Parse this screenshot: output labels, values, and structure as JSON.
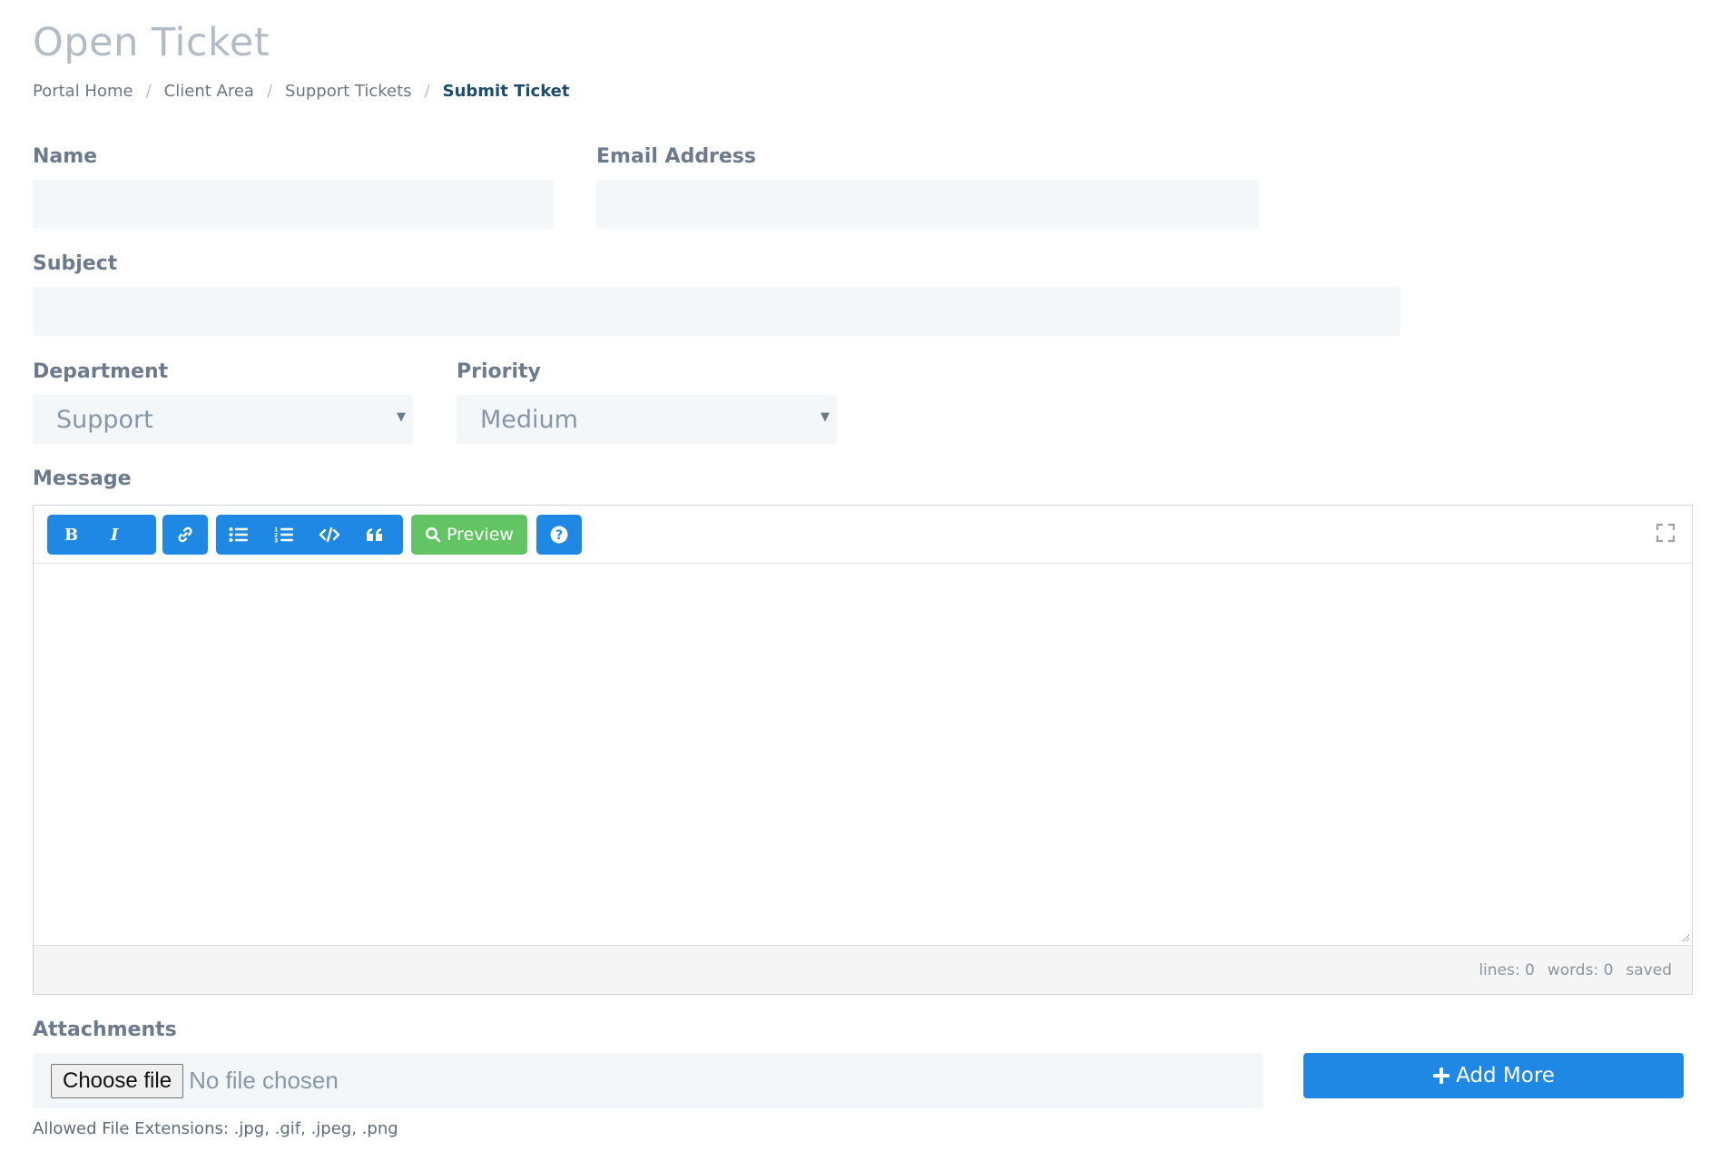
{
  "page": {
    "title": "Open Ticket"
  },
  "breadcrumb": [
    "Portal Home",
    "Client Area",
    "Support Tickets",
    "Submit Ticket"
  ],
  "form": {
    "name_label": "Name",
    "name_value": "",
    "email_label": "Email Address",
    "email_value": "",
    "subject_label": "Subject",
    "subject_value": "",
    "department_label": "Department",
    "department_value": "Support",
    "priority_label": "Priority",
    "priority_value": "Medium",
    "message_label": "Message",
    "attachments_label": "Attachments"
  },
  "editor": {
    "toolbar": {
      "icons": [
        "bold-icon",
        "italic-icon",
        "link-icon",
        "unordered-list-icon",
        "ordered-list-icon",
        "code-icon",
        "quote-icon",
        "search-icon",
        "help-icon",
        "fullscreen-icon"
      ],
      "preview_label": "Preview"
    },
    "status": {
      "lines": "lines: 0",
      "words": "words: 0",
      "saved": "saved"
    }
  },
  "attachments": {
    "choose_label": "Choose file",
    "no_file_label": "No file chosen",
    "add_more_label": "Add More",
    "allowed_text": "Allowed File Extensions: .jpg, .gif, .jpeg, .png"
  },
  "colors": {
    "primary": "#1f88e5",
    "preview_green": "#62c462",
    "field_bg": "#f3f7fa",
    "label": "#6b7a8c",
    "active_crumb": "#1b4e6e"
  }
}
